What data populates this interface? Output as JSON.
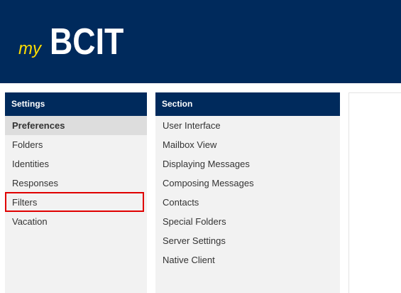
{
  "header": {
    "logo_my": "my",
    "logo_brand": "BCIT"
  },
  "settings": {
    "title": "Settings",
    "items": [
      {
        "label": "Preferences",
        "selected": true
      },
      {
        "label": "Folders"
      },
      {
        "label": "Identities"
      },
      {
        "label": "Responses"
      },
      {
        "label": "Filters",
        "highlighted": true
      },
      {
        "label": "Vacation"
      }
    ]
  },
  "section": {
    "title": "Section",
    "items": [
      {
        "label": "User Interface"
      },
      {
        "label": "Mailbox View"
      },
      {
        "label": "Displaying Messages"
      },
      {
        "label": "Composing Messages"
      },
      {
        "label": "Contacts"
      },
      {
        "label": "Special Folders"
      },
      {
        "label": "Server Settings"
      },
      {
        "label": "Native Client"
      }
    ]
  },
  "colors": {
    "brand_navy": "#002a5c",
    "logo_yellow": "#ffdd00",
    "highlight_red": "#e00000",
    "panel_bg": "#f2f2f2",
    "selected_bg": "#dddddd"
  }
}
